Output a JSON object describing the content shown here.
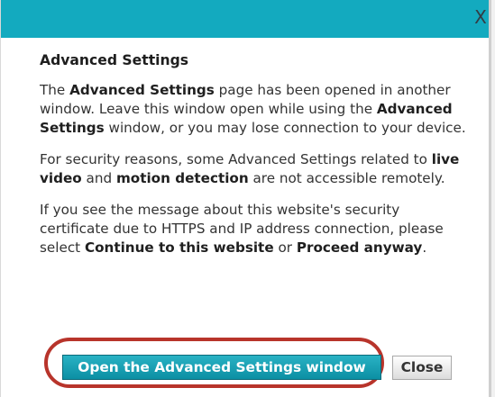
{
  "title_bar": {
    "close_symbol": "X",
    "accent_color": "#13aabf"
  },
  "dialog": {
    "heading": "Advanced Settings",
    "paragraphs": {
      "p1": {
        "t1": "The ",
        "b1": "Advanced Settings",
        "t2": " page has been opened in another window. Leave this window open while using the ",
        "b2": "Advanced Settings",
        "t3": " window, or you may lose connection to your device."
      },
      "p2": {
        "t1": "For security reasons, some Advanced Settings related to ",
        "b1": "live video",
        "t2": " and ",
        "b2": "motion detection",
        "t3": " are not accessible remotely."
      },
      "p3": {
        "t1": "If you see the message about this website's security certificate due to HTTPS and IP address connection, please select ",
        "b1": "Continue to this website",
        "t2": " or ",
        "b2": "Proceed anyway",
        "t3": "."
      }
    }
  },
  "buttons": {
    "open_advanced_settings": "Open the Advanced Settings window",
    "close": "Close"
  },
  "highlight": {
    "color": "#b8342b"
  },
  "icons": {
    "titlebar_close": "close-icon"
  }
}
